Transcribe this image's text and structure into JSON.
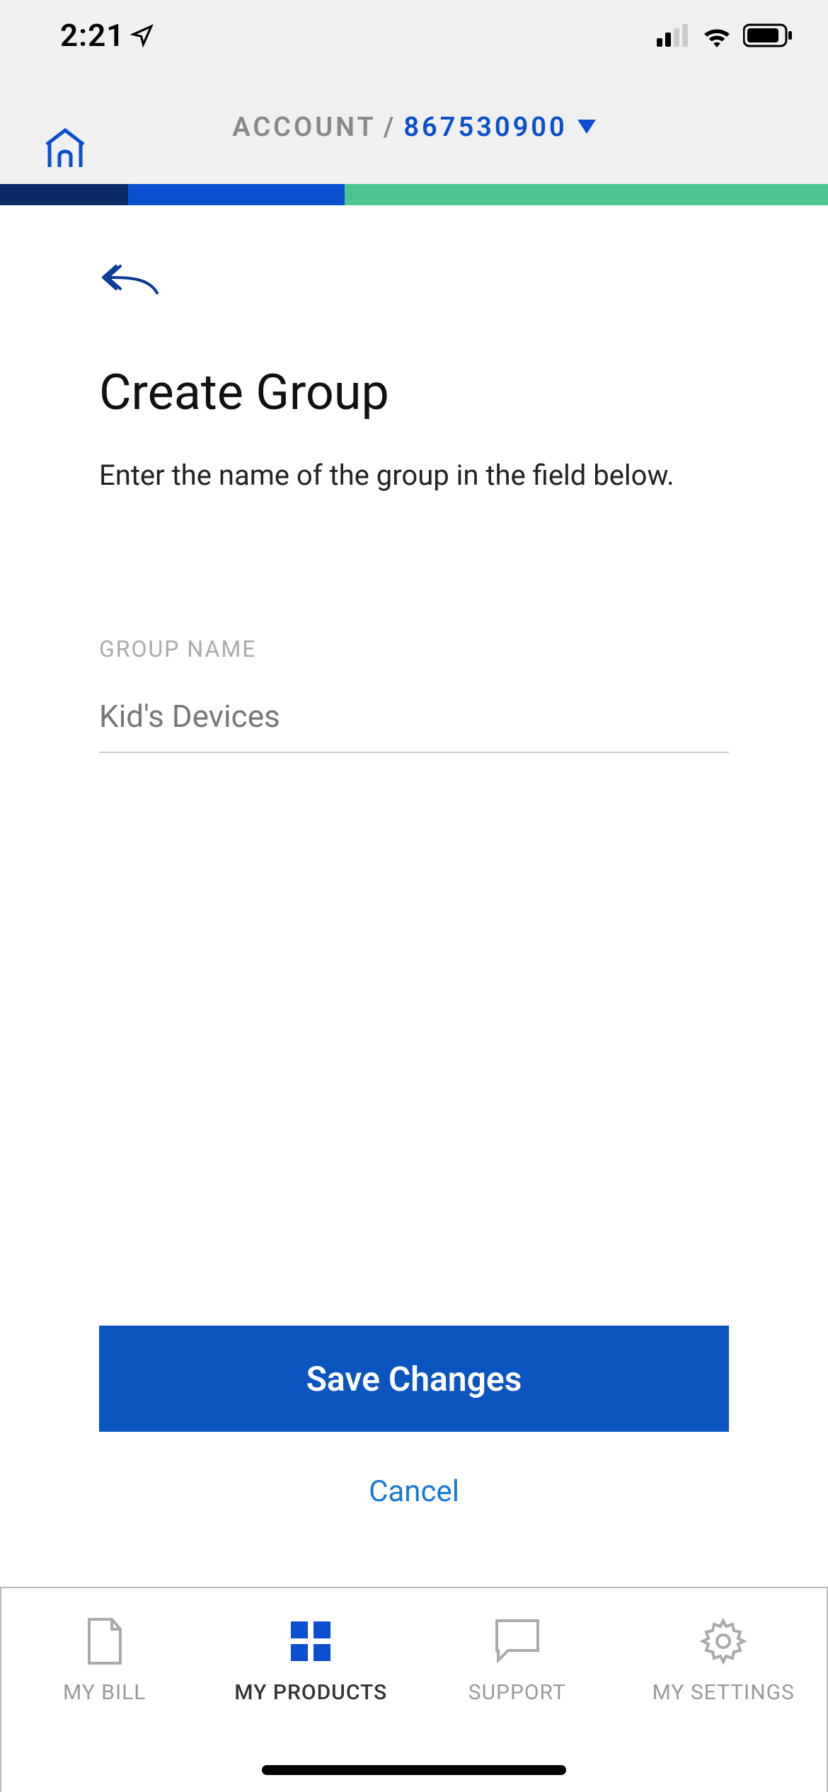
{
  "status": {
    "time": "2:21"
  },
  "header": {
    "breadcrumb_label": "ACCOUNT",
    "separator": "/",
    "account_number": "867530900"
  },
  "main": {
    "title": "Create Group",
    "subtitle": "Enter the name of the group in the field below.",
    "field_label": "GROUP NAME",
    "input_placeholder": "Kid's Devices",
    "input_value": "",
    "save_label": "Save Changes",
    "cancel_label": "Cancel"
  },
  "nav": {
    "items": [
      {
        "label": "MY BILL",
        "active": false
      },
      {
        "label": "MY PRODUCTS",
        "active": true
      },
      {
        "label": "SUPPORT",
        "active": false
      },
      {
        "label": "MY SETTINGS",
        "active": false
      }
    ]
  },
  "colors": {
    "brand_blue": "#0a4fcf",
    "button_blue": "#0a55c0",
    "accent_green": "#4dc591"
  }
}
